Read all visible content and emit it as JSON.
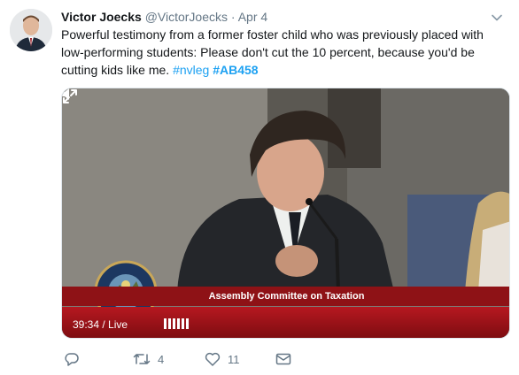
{
  "tweet": {
    "author_name": "Victor Joecks",
    "author_handle": "@VictorJoecks",
    "separator": "·",
    "date": "Apr 4",
    "text": "Powerful testimony from a former foster child who was previously placed with low-performing students: Please don't cut the 10 percent, because you'd be cutting kids like me.",
    "hashtags": [
      "#nvleg",
      "#AB458"
    ]
  },
  "video": {
    "lower_third": "Assembly Committee on Taxation",
    "seal_text": "THE GREAT SEAL OF THE STATE OF NEVADA",
    "time": "39:34",
    "time_separator": " / ",
    "live_label": "Live",
    "volume_level_bars": 6
  },
  "actions": {
    "reply_count": "",
    "retweet_count": "4",
    "like_count": "11"
  },
  "icons": {
    "caret": "chevron-down-icon",
    "reply": "reply-icon",
    "retweet": "retweet-icon",
    "like": "heart-icon",
    "message": "envelope-icon",
    "volume": "speaker-icon",
    "fullscreen": "expand-icon"
  },
  "colors": {
    "link": "#1da1f2",
    "muted": "#657786",
    "broadcast_red": "#8e1216"
  }
}
